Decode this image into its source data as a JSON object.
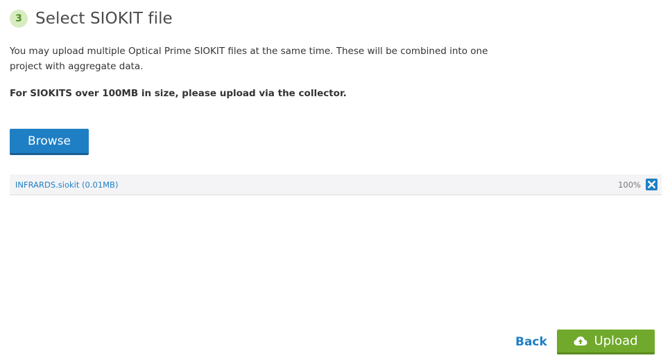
{
  "step": {
    "number": "3",
    "title": "Select SIOKIT file"
  },
  "intro_text": "You may upload multiple Optical Prime SIOKIT files at the same time. These will be combined into one project with aggregate data.",
  "notice_text": "For SIOKITS over 100MB in size, please upload via the collector.",
  "browse_label": "Browse",
  "files": [
    {
      "name": "INFRARDS.siokit (0.01MB)",
      "progress": "100%"
    }
  ],
  "footer": {
    "back_label": "Back",
    "upload_label": "Upload"
  },
  "colors": {
    "primary_blue": "#1f7fc4",
    "upload_green": "#70a92b",
    "step_badge_bg": "#d7ecc0",
    "step_badge_text": "#4e8c1f"
  },
  "icons": {
    "remove": "close-icon",
    "upload": "cloud-upload-icon"
  }
}
